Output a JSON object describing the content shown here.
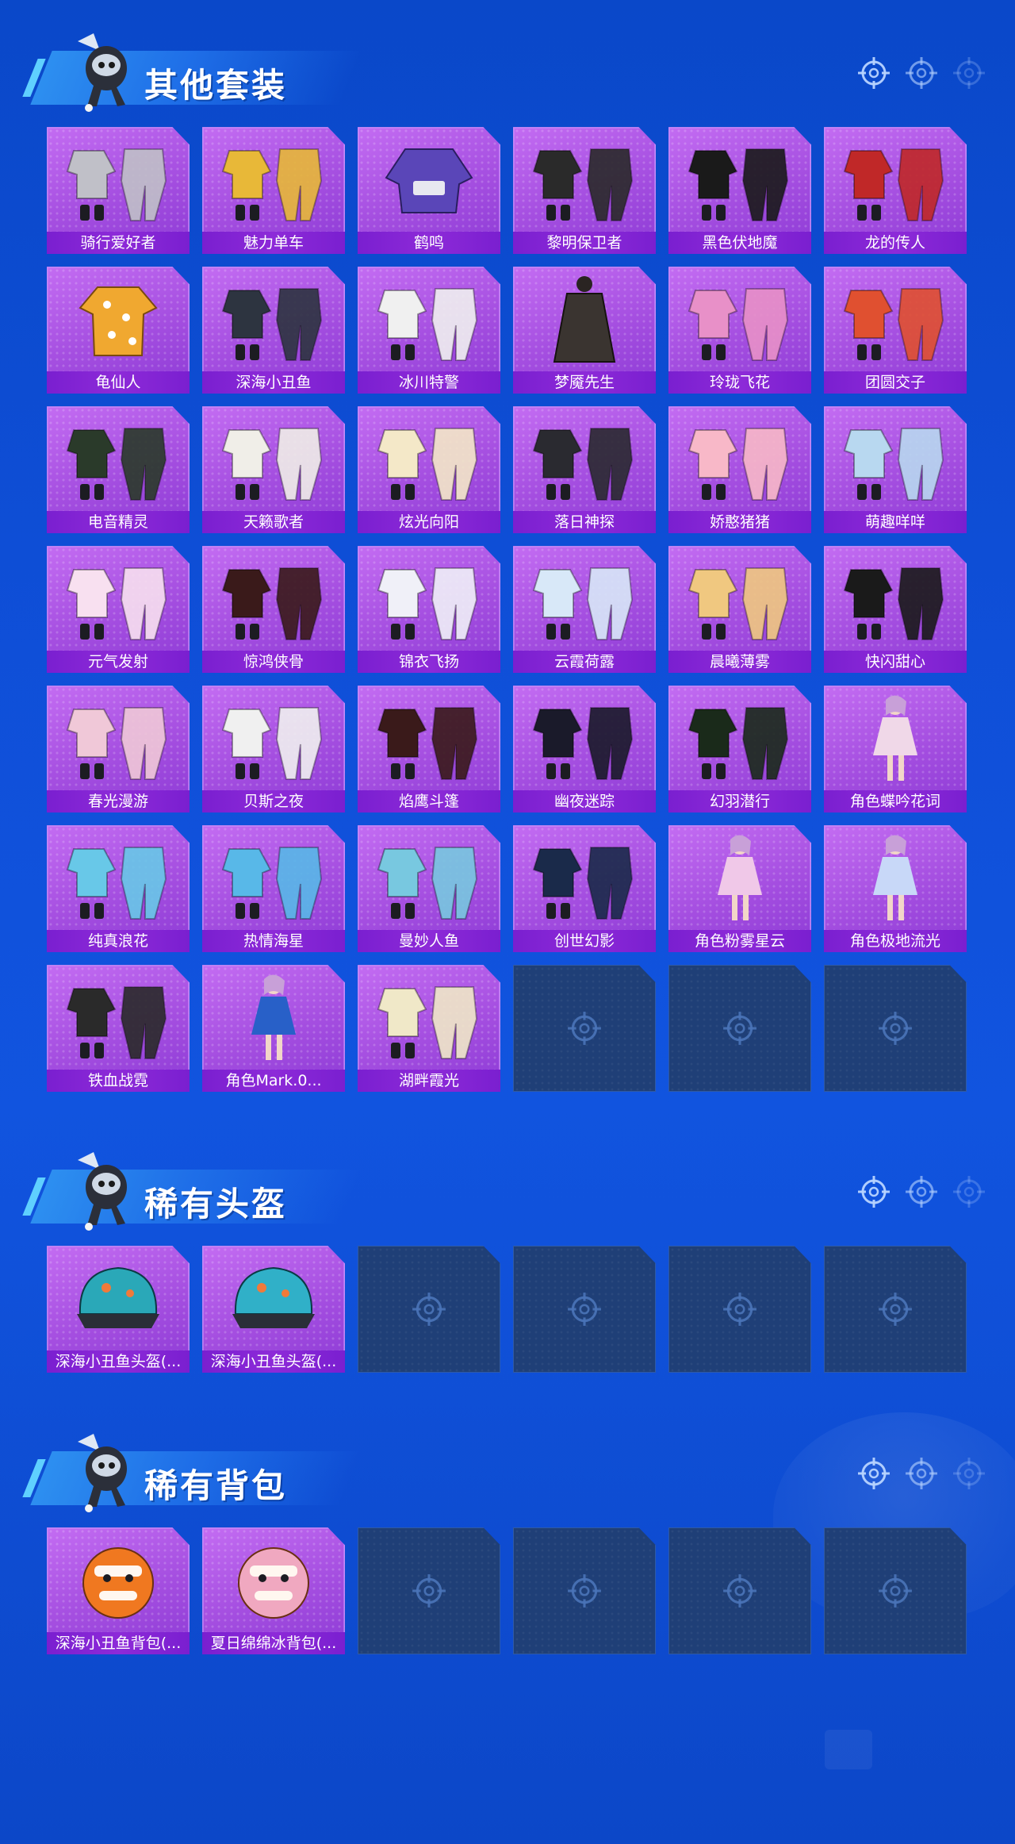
{
  "sections": [
    {
      "title": "其他套装",
      "items": [
        {
          "label": "骑行爱好者",
          "kind": "outfit",
          "color": "#c0c0c8"
        },
        {
          "label": "魅力单车",
          "kind": "outfit",
          "color": "#e8b838"
        },
        {
          "label": "鹤鸣",
          "kind": "hoodie",
          "color": "#5a46b8"
        },
        {
          "label": "黎明保卫者",
          "kind": "outfit",
          "color": "#2a2a2a"
        },
        {
          "label": "黑色伏地魔",
          "kind": "outfit",
          "color": "#1a1a1a"
        },
        {
          "label": "龙的传人",
          "kind": "outfit",
          "color": "#c02828"
        },
        {
          "label": "龟仙人",
          "kind": "shirt",
          "color": "#f0a830"
        },
        {
          "label": "深海小丑鱼",
          "kind": "outfit",
          "color": "#2d3440"
        },
        {
          "label": "冰川特警",
          "kind": "outfit",
          "color": "#f0f0f0"
        },
        {
          "label": "梦魇先生",
          "kind": "coat",
          "color": "#3a3430"
        },
        {
          "label": "玲珑飞花",
          "kind": "outfit",
          "color": "#e890c8"
        },
        {
          "label": "团圆交子",
          "kind": "outfit",
          "color": "#e05030"
        },
        {
          "label": "电音精灵",
          "kind": "outfit",
          "color": "#2a3a2a"
        },
        {
          "label": "天籁歌者",
          "kind": "outfit",
          "color": "#f0eee8"
        },
        {
          "label": "炫光向阳",
          "kind": "outfit",
          "color": "#f4e8c8"
        },
        {
          "label": "落日神探",
          "kind": "outfit",
          "color": "#2a2a30"
        },
        {
          "label": "娇憨猪猪",
          "kind": "outfit",
          "color": "#f8b8c8"
        },
        {
          "label": "萌趣咩咩",
          "kind": "outfit",
          "color": "#b8d8f0"
        },
        {
          "label": "元气发射",
          "kind": "outfit",
          "color": "#f8e0f0"
        },
        {
          "label": "惊鸿侠骨",
          "kind": "outfit",
          "color": "#3a1a1a"
        },
        {
          "label": "锦衣飞扬",
          "kind": "outfit",
          "color": "#f0f0f8"
        },
        {
          "label": "云霞荷露",
          "kind": "outfit",
          "color": "#d8e8f8"
        },
        {
          "label": "晨曦薄雾",
          "kind": "outfit",
          "color": "#f0c880"
        },
        {
          "label": "快闪甜心",
          "kind": "outfit",
          "color": "#1a1a1a"
        },
        {
          "label": "春光漫游",
          "kind": "outfit",
          "color": "#f0c8d8"
        },
        {
          "label": "贝斯之夜",
          "kind": "outfit",
          "color": "#f0f0f0"
        },
        {
          "label": "焰鹰斗篷",
          "kind": "outfit",
          "color": "#3a1a1a"
        },
        {
          "label": "幽夜迷踪",
          "kind": "outfit",
          "color": "#1a1a2a"
        },
        {
          "label": "幻羽潜行",
          "kind": "outfit",
          "color": "#1a2a1a"
        },
        {
          "label": "角色蝶吟花词",
          "kind": "character",
          "color": "#f0d8e8"
        },
        {
          "label": "纯真浪花",
          "kind": "outfit",
          "color": "#68c8e8"
        },
        {
          "label": "热情海星",
          "kind": "outfit",
          "color": "#58b8e8"
        },
        {
          "label": "曼妙人鱼",
          "kind": "outfit",
          "color": "#78c8e0"
        },
        {
          "label": "创世幻影",
          "kind": "outfit",
          "color": "#1a2a4a"
        },
        {
          "label": "角色粉雾星云",
          "kind": "character",
          "color": "#f0c8e8"
        },
        {
          "label": "角色极地流光",
          "kind": "character",
          "color": "#c8d8f8"
        },
        {
          "label": "铁血战霓",
          "kind": "outfit",
          "color": "#2a2a2a"
        },
        {
          "label": "角色Mark.0...",
          "kind": "character",
          "color": "#2860c8"
        },
        {
          "label": "湖畔霞光",
          "kind": "outfit",
          "color": "#f0e8c8"
        }
      ],
      "empty_slots": 3
    },
    {
      "title": "稀有头盔",
      "items": [
        {
          "label": "深海小丑鱼头盔(...",
          "kind": "helmet",
          "color": "#2aa8b8"
        },
        {
          "label": "深海小丑鱼头盔(...",
          "kind": "helmet",
          "color": "#30b0c8"
        }
      ],
      "empty_slots": 4
    },
    {
      "title": "稀有背包",
      "items": [
        {
          "label": "深海小丑鱼背包(...",
          "kind": "backpack",
          "color": "#f07820"
        },
        {
          "label": "夏日绵绵冰背包(...",
          "kind": "backpack",
          "color": "#f0a8c0"
        }
      ],
      "empty_slots": 4
    }
  ],
  "colors": {
    "background": "#0f4fd8",
    "card_purple": "#a44ee0",
    "label_purple": "#7a1fd0",
    "empty_slot": "#1f3f77"
  },
  "icons": {
    "header_reticle": "crosshair-icon",
    "empty_slot": "crosshair-icon",
    "mascot": "mascot-icon"
  }
}
